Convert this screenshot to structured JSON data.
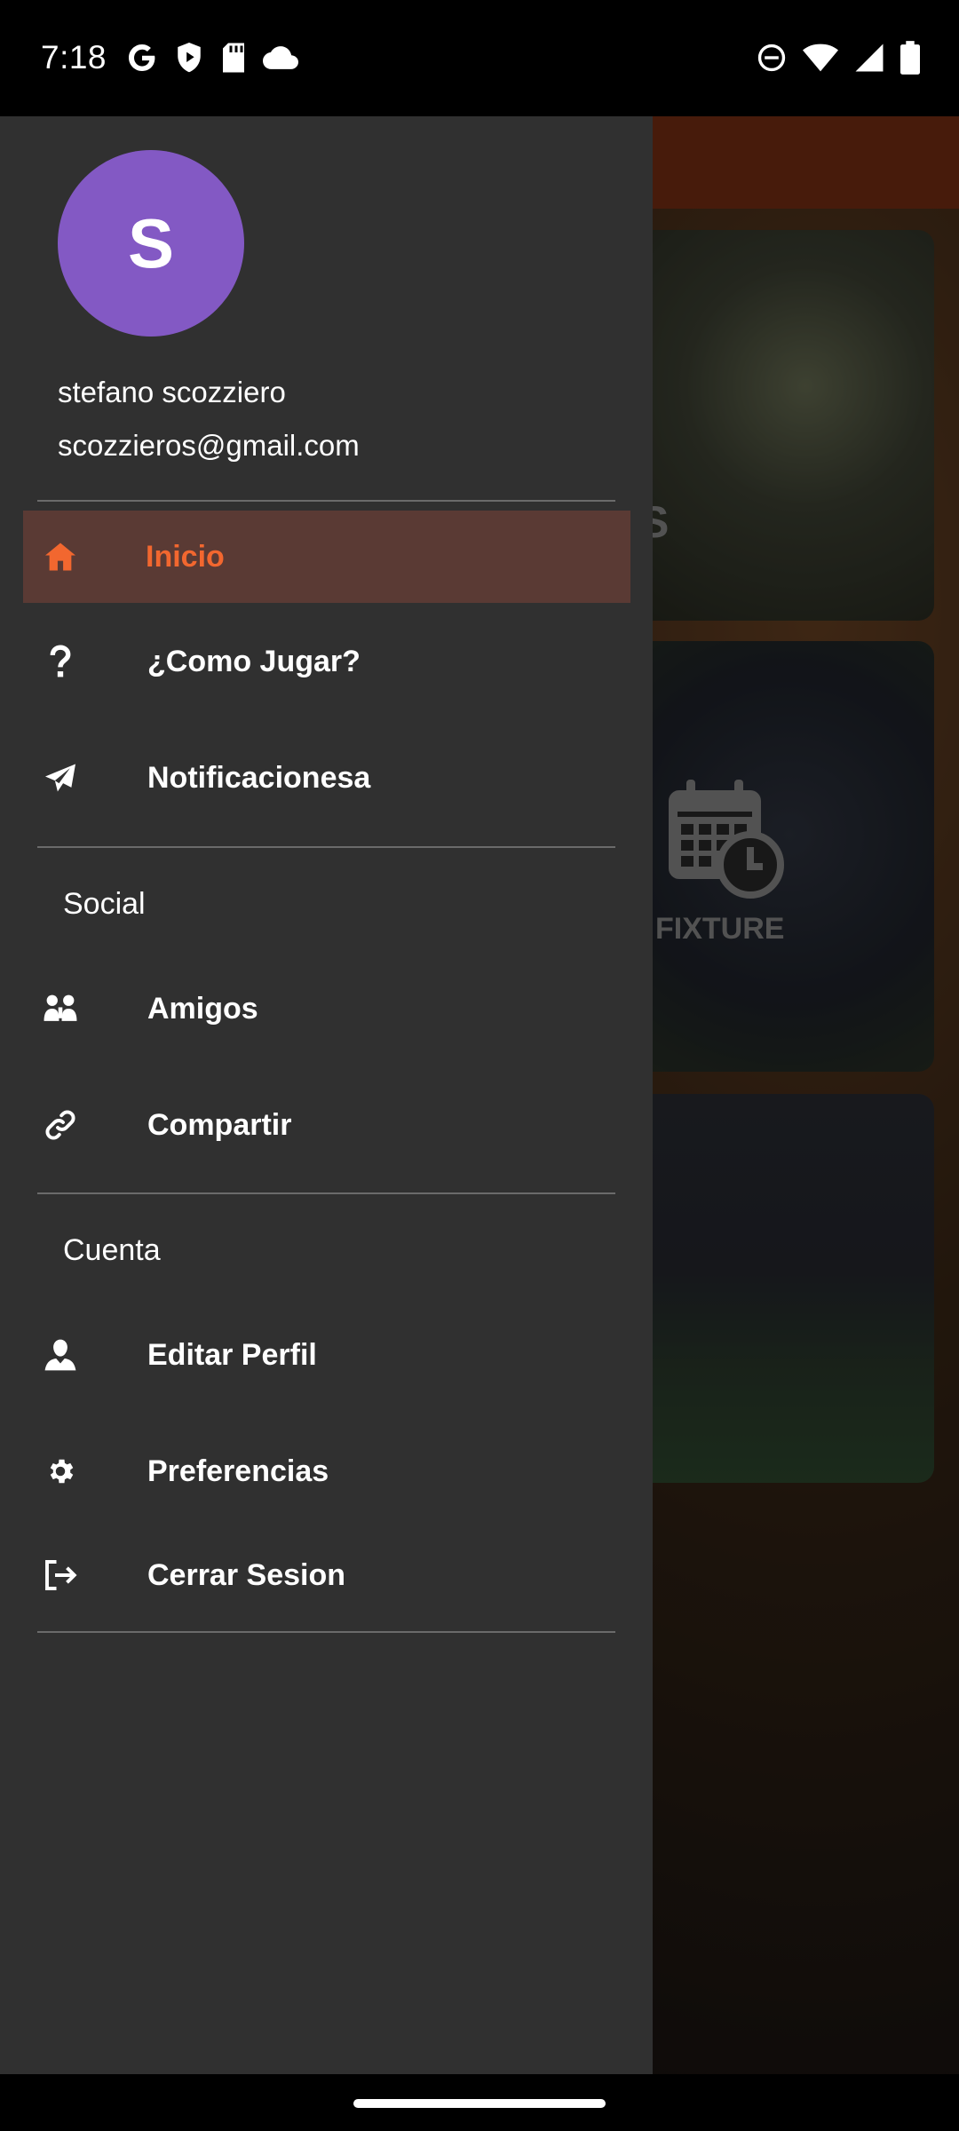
{
  "status_bar": {
    "time": "7:18",
    "notification_icons": [
      "google-icon",
      "play-shield-icon",
      "sd-card-icon",
      "cloud-icon"
    ],
    "system_icons": [
      "do-not-disturb-icon",
      "wifi-icon",
      "signal-icon",
      "battery-icon"
    ]
  },
  "background_app": {
    "card_1_text": "S",
    "card_2_text": "FIXTURE",
    "app_bar_color": "#7a2f14"
  },
  "drawer": {
    "avatar_initial": "S",
    "avatar_color": "#8359c4",
    "user_name": "stefano scozziero",
    "user_email": "scozzieros@gmail.com",
    "items": [
      {
        "label": "Inicio",
        "icon": "home-icon",
        "active": true
      },
      {
        "label": "¿Como Jugar?",
        "icon": "question-icon",
        "active": false
      },
      {
        "label": "Notificacionesa",
        "icon": "send-icon",
        "active": false
      }
    ],
    "social": {
      "header": "Social",
      "items": [
        {
          "label": "Amigos",
          "icon": "friends-icon"
        },
        {
          "label": "Compartir",
          "icon": "link-icon"
        }
      ]
    },
    "account": {
      "header": "Cuenta",
      "items": [
        {
          "label": "Editar Perfil",
          "icon": "person-icon"
        },
        {
          "label": "Preferencias",
          "icon": "gear-icon"
        },
        {
          "label": "Cerrar Sesion",
          "icon": "logout-icon"
        }
      ]
    },
    "accent_color": "#f2672f"
  }
}
